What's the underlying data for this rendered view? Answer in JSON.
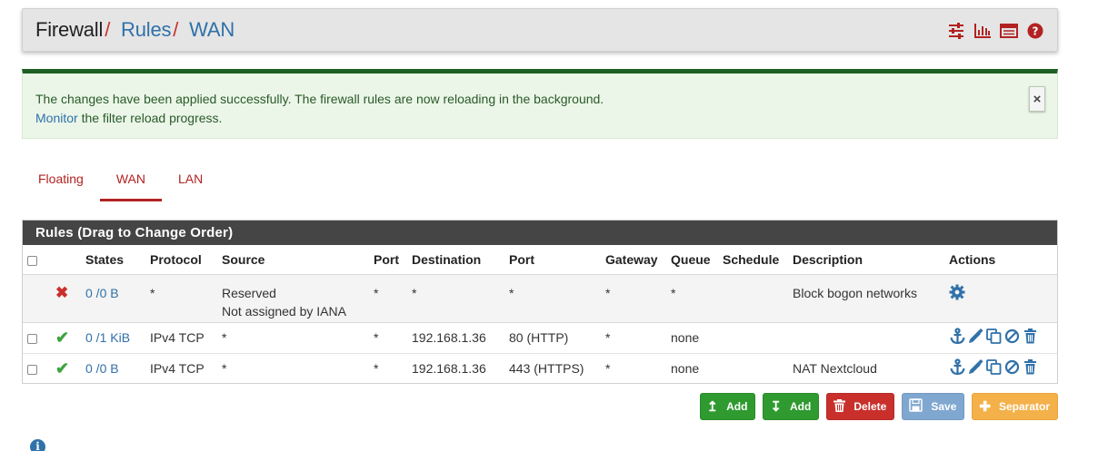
{
  "breadcrumb": {
    "items": [
      "Firewall",
      "Rules",
      "WAN"
    ],
    "separator": "/"
  },
  "header_icons": [
    "sliders-icon",
    "bar-chart-icon",
    "list-table-icon",
    "help-icon"
  ],
  "alert": {
    "line1": "The changes have been applied successfully. The firewall rules are now reloading in the background.",
    "link": "Monitor",
    "line2_rest": " the filter reload progress.",
    "close": "×"
  },
  "tabs": [
    {
      "label": "Floating",
      "active": false
    },
    {
      "label": "WAN",
      "active": true
    },
    {
      "label": "LAN",
      "active": false
    }
  ],
  "panel": {
    "title": "Rules (Drag to Change Order)",
    "columns": [
      "",
      "States",
      "Protocol",
      "Source",
      "Port",
      "Destination",
      "Port",
      "Gateway",
      "Queue",
      "Schedule",
      "Description",
      "Actions"
    ],
    "bogon_row": {
      "states": "0 /0 B",
      "protocol": "*",
      "source_line1": "Reserved",
      "source_line2": "Not assigned by IANA",
      "source_port": "*",
      "destination": "*",
      "destination_port": "*",
      "gateway": "*",
      "queue": "*",
      "schedule": "",
      "description": "Block bogon networks"
    },
    "rows": [
      {
        "states": "0 /1 KiB",
        "protocol": "IPv4 TCP",
        "source": "*",
        "source_port": "*",
        "destination": "192.168.1.36",
        "destination_port": "80 (HTTP)",
        "gateway": "*",
        "queue": "none",
        "schedule": "",
        "description": ""
      },
      {
        "states": "0 /0 B",
        "protocol": "IPv4 TCP",
        "source": "*",
        "source_port": "*",
        "destination": "192.168.1.36",
        "destination_port": "443 (HTTPS)",
        "gateway": "*",
        "queue": "none",
        "schedule": "",
        "description": "NAT Nextcloud"
      }
    ]
  },
  "buttons": {
    "add_top": "Add",
    "add_bottom": "Add",
    "delete": "Delete",
    "save": "Save",
    "separator": "Separator"
  },
  "colors": {
    "brand_red": "#b22222",
    "link_blue": "#3071a9",
    "success_green": "#2f9a2f",
    "panel_heading": "#454545",
    "alert_bg": "#ebf6e8"
  }
}
